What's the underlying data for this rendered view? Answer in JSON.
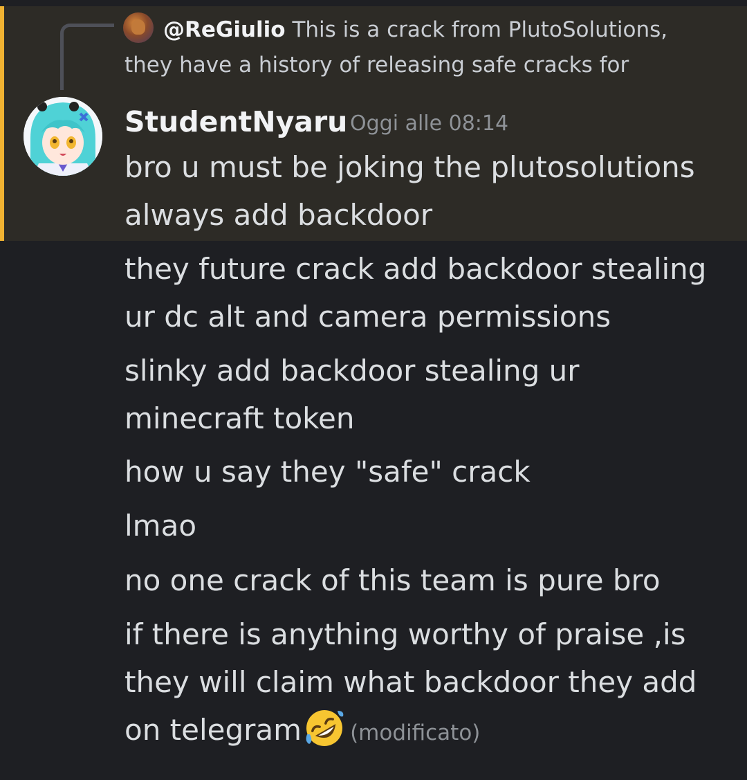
{
  "reply": {
    "username": "@ReGiulio",
    "text_line1": "This is a crack from PlutoSolutions,",
    "text_line2": "they have a history of releasing safe cracks for"
  },
  "author": {
    "name": "StudentNyaru",
    "timestamp": "Oggi alle 08:14"
  },
  "messages": [
    {
      "line1": "bro u must be joking the plutosolutions",
      "line2": "always add backdoor"
    },
    {
      "line1": "they future crack add backdoor stealing",
      "line2": "ur dc alt and camera permissions"
    },
    {
      "line1": "slinky add backdoor stealing ur",
      "line2": "minecraft token"
    },
    {
      "line1": "how u say they \"safe\" crack"
    },
    {
      "line1": "lmao"
    },
    {
      "line1": "no one crack of this team is pure bro"
    },
    {
      "line1": "if there is anything worthy of praise ,is",
      "line2": "they will claim what backdoor they add",
      "line3": "on telegram",
      "emoji": "rolling-on-floor-laughing-emoji",
      "edited": "(modificato)"
    }
  ],
  "colors": {
    "background": "#1e1f23",
    "highlight": "#2d2b26",
    "mention_bar": "#f0b232",
    "text": "#dbdee1",
    "muted": "#8e9297"
  }
}
